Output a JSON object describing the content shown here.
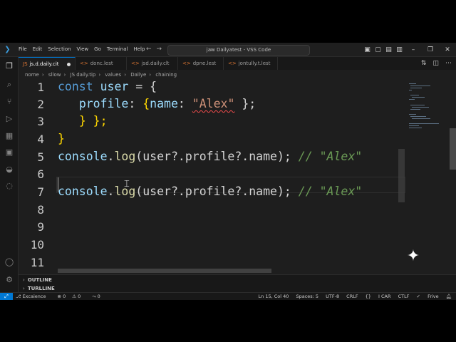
{
  "window": {
    "menu": [
      "File",
      "Edit",
      "Selection",
      "View",
      "Go",
      "Terminal",
      "Help"
    ],
    "title": "jaw Dailyatest - VSS Code"
  },
  "tabs": [
    {
      "label": "js.d.daily.cit",
      "active": true,
      "modified": true
    },
    {
      "label": "donc.lest",
      "active": false
    },
    {
      "label": "jsd.daily.clt",
      "active": false
    },
    {
      "label": "dpne.lest",
      "active": false
    },
    {
      "label": "jontully.t.lest",
      "active": false
    }
  ],
  "breadcrumb": [
    "nome",
    "sllow",
    "JS daily.tip",
    "values",
    "Dallye",
    "chaining"
  ],
  "editor": {
    "line_numbers": [
      "1",
      "2",
      "3",
      "4",
      "5",
      "6",
      "7",
      "8",
      "9",
      "10",
      "11"
    ],
    "lines": {
      "l1": {
        "kw": "const",
        "var": "user",
        "rest": " = {"
      },
      "l2": {
        "prop": "profile",
        "sep": ": ",
        "brace": "{",
        "prop2": "name",
        "sep2": ": ",
        "str": "\"Alex\"",
        "rest": " };"
      },
      "l3": {
        "text": "} };"
      },
      "l4": {
        "text": "}"
      },
      "l5": {
        "obj": "console",
        "dot": ".",
        "fn": "log",
        "args": "(user?.profile?.name);",
        "comment": "// \"Alex\""
      },
      "l7": {
        "obj": "console",
        "dot": ".",
        "fn": "log",
        "args": "(user?.profile?.name);",
        "comment": "// \"Alex\""
      }
    }
  },
  "panels": {
    "outline": "OUTLINE",
    "timeline": "TURLLINE"
  },
  "statusbar": {
    "left": [
      "Excaience",
      "0",
      "0",
      "0"
    ],
    "right": [
      "Ln 15, Col 40",
      "Spaces: 5",
      "UTF-8",
      "CRLF",
      "I CAR",
      "CTLF",
      "Frive"
    ]
  },
  "colors": {
    "accent": "#0078d4",
    "editor_bg": "#1e1e1e",
    "keyword": "#569cd6",
    "string": "#ce9178",
    "comment": "#6a9955",
    "function": "#dcdcaa"
  },
  "icons": {
    "activity": [
      "files-icon",
      "search-icon",
      "source-control-icon",
      "run-debug-icon",
      "extensions-icon",
      "remote-explorer-icon",
      "testing-icon",
      "account-icon",
      "settings-gear-icon"
    ]
  }
}
